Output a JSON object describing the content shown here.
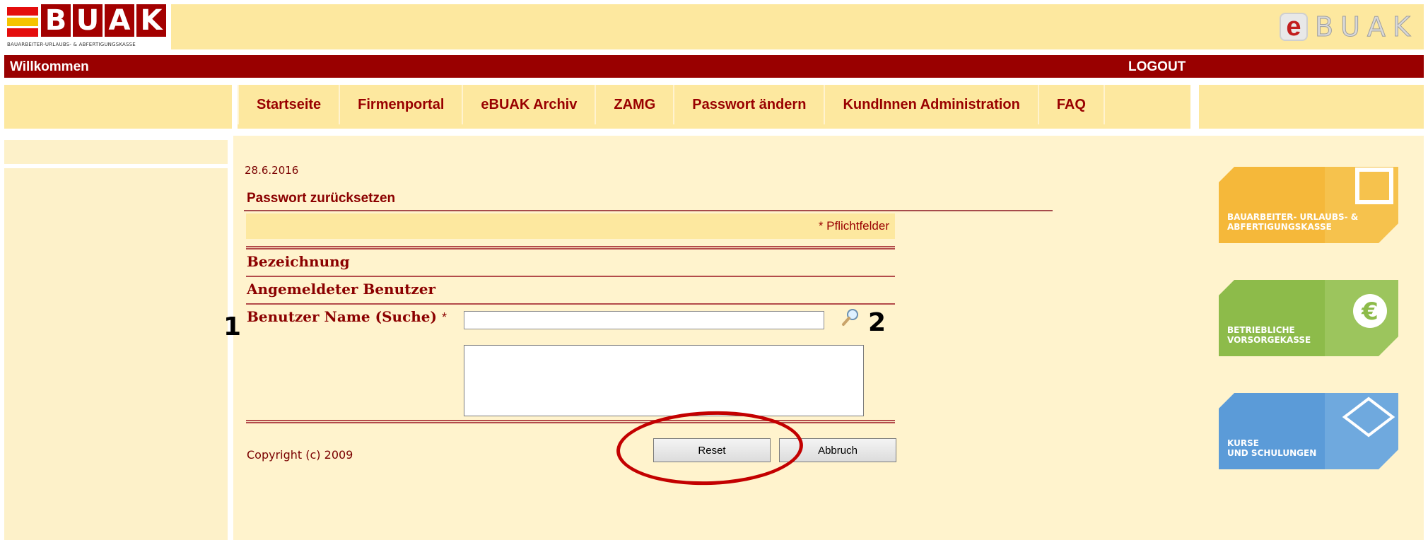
{
  "header": {
    "logo_letters": [
      "B",
      "U",
      "A",
      "K"
    ],
    "logo_subtitle": "BAUARBEITER-URLAUBS- & ABFERTIGUNGSKASSE",
    "ebuak_e": "e",
    "ebuak_text": "BUAK"
  },
  "welcome_bar": {
    "welcome": "Willkommen",
    "logout": "LOGOUT"
  },
  "nav": {
    "items": [
      {
        "label": "Startseite"
      },
      {
        "label": "Firmenportal"
      },
      {
        "label": "eBUAK Archiv"
      },
      {
        "label": "ZAMG"
      },
      {
        "label": "Passwort ändern"
      },
      {
        "label": "KundInnen Administration"
      },
      {
        "label": "FAQ"
      }
    ]
  },
  "content": {
    "date": "28.6.2016",
    "title": "Passwort zurücksetzen",
    "required_note": "* Pflichtfelder",
    "section_designation": "Bezeichnung",
    "section_logged_user": "Angemeldeter Benutzer",
    "field_label": "Benutzer Name (Suche)",
    "field_required_marker": "*",
    "search_value": "",
    "annotation_1": "1",
    "annotation_2": "2",
    "copyright": "Copyright (c) 2009",
    "reset_label": "Reset",
    "cancel_label": "Abbruch"
  },
  "tiles": [
    {
      "label": "BAUARBEITER- URLAUBS- &\nABFERTIGUNGSKASSE",
      "color": "#f5b83a",
      "icon": "square-icon"
    },
    {
      "label": "BETRIEBLICHE\nVORSORGEKASSE",
      "color": "#8dbb4a",
      "icon": "euro-icon"
    },
    {
      "label": "KURSE\nUND SCHULUNGEN",
      "color": "#5b9bd8",
      "icon": "diamond-icon"
    }
  ],
  "colors": {
    "brand_red": "#990000",
    "band_yellow": "#fde89f",
    "content_bg": "#fff3cd",
    "highlight_oval": "#c30000"
  }
}
